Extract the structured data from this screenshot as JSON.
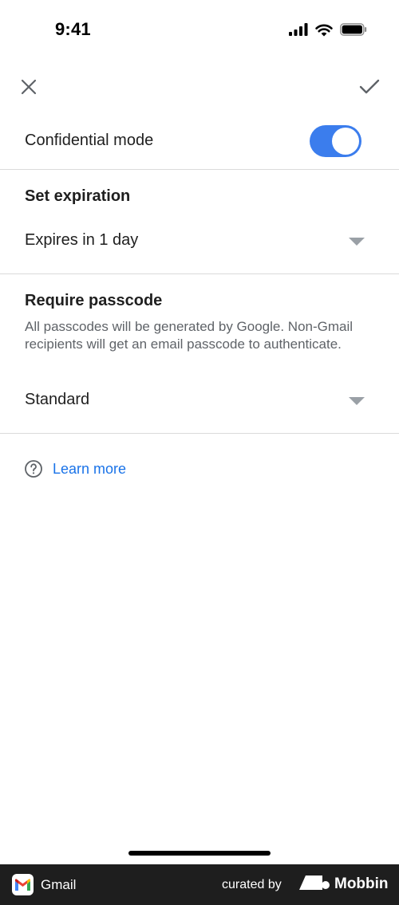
{
  "status_bar": {
    "time": "9:41"
  },
  "toolbar": {
    "close_icon": "close-icon",
    "confirm_icon": "check-icon"
  },
  "confidential": {
    "label": "Confidential mode",
    "enabled": true,
    "accent_color": "#3b7ded"
  },
  "expiration": {
    "title": "Set expiration",
    "value": "Expires in 1 day"
  },
  "passcode": {
    "title": "Require passcode",
    "description": "All passcodes will be generated by Google. Non-Gmail recipients will get an email passcode to authenticate.",
    "value": "Standard"
  },
  "help": {
    "icon": "help-circle-icon",
    "link": "Learn more",
    "link_color": "#1a73e8"
  },
  "footer": {
    "app_name": "Gmail",
    "curated_label": "curated by",
    "brand": "Mobbin"
  }
}
